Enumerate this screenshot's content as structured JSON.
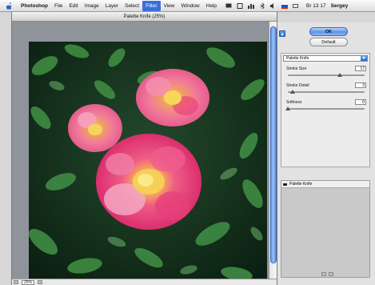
{
  "menubar": {
    "app_name": "Photoshop",
    "items": [
      "File",
      "Edit",
      "Image",
      "Layer",
      "Select",
      "Filter",
      "View",
      "Window",
      "Help"
    ],
    "active_item": "Filter",
    "clock": "Br 13 17",
    "user": "Sergey"
  },
  "window": {
    "title": "Palette Knife (25%)"
  },
  "statusbar": {
    "zoom": "25%"
  },
  "panel": {
    "ok_label": "OK",
    "default_label": "Default",
    "filter_select": "Palette Knife",
    "params": [
      {
        "label": "Stroke Size",
        "value": "17",
        "fraction": 0.68
      },
      {
        "label": "Stroke Detail",
        "value": "3",
        "fraction": 0.06
      },
      {
        "label": "Softness",
        "value": "0",
        "fraction": 0.0
      }
    ],
    "layer_name": "Palette Knife"
  },
  "colors": {
    "accent": "#3b6ed8",
    "foliage_dark": "#0f2a17",
    "petal_pink": "#e8467a",
    "flower_center": "#f6d95a"
  },
  "icons": [
    "apple-icon",
    "eye-icon",
    "collapse-arrow-icon",
    "dropdown-arrow-icon"
  ]
}
